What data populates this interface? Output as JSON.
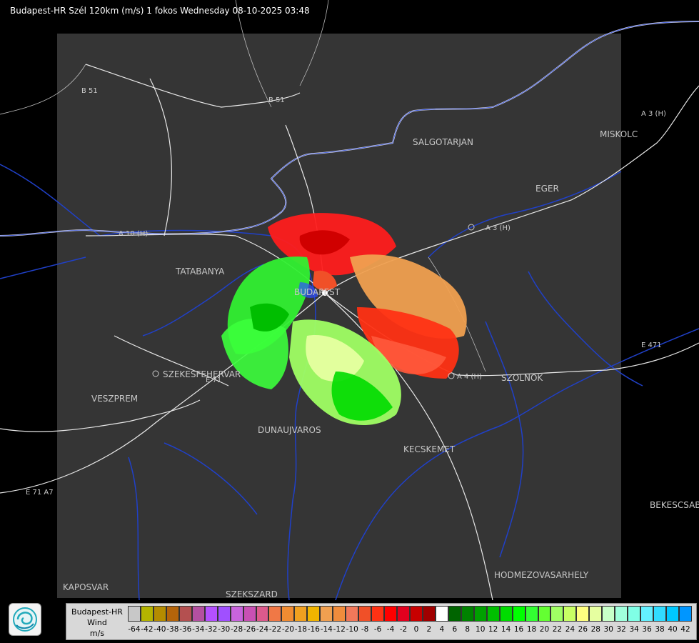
{
  "title": "Budapest-HR Szél 120km (m/s) 1 fokos Wednesday 08-10-2025 03:48",
  "cities": [
    {
      "name": "SALGOTARJAN"
    },
    {
      "name": "EGER"
    },
    {
      "name": "MISKOLC"
    },
    {
      "name": "TATABANYA"
    },
    {
      "name": "BUDAPEST"
    },
    {
      "name": "SZEKESFEHERVAR"
    },
    {
      "name": "VESZPREM"
    },
    {
      "name": "DUNAUJVAROS"
    },
    {
      "name": "KECSKEMET"
    },
    {
      "name": "SZOLNOK"
    },
    {
      "name": "HODMEZOVASARHELY"
    },
    {
      "name": "KAPOSVAR"
    },
    {
      "name": "SZEKSZARD"
    },
    {
      "name": "BEKESCSABA"
    }
  ],
  "roads": [
    {
      "name": "B 51"
    },
    {
      "name": "B 51"
    },
    {
      "name": "A 3 (H)"
    },
    {
      "name": "A 3 (H)"
    },
    {
      "name": "A 4 (H)"
    },
    {
      "name": "A 10 (H)"
    },
    {
      "name": "E 71"
    },
    {
      "name": "E 471"
    },
    {
      "name": "E 71 A7"
    }
  ],
  "legend": {
    "line1": "Budapest-HR",
    "line2": "Wind",
    "line3": "m/s",
    "colors": [
      "#c8c8c8",
      "#b4b400",
      "#b48c00",
      "#b4640a",
      "#b45050",
      "#b450a0",
      "#b450ff",
      "#a050ff",
      "#c864dc",
      "#c850b4",
      "#dc5a8c",
      "#f07846",
      "#f08c32",
      "#f0a020",
      "#f0b400",
      "#f0a050",
      "#f08c3c",
      "#f0785a",
      "#f05028",
      "#ff3214",
      "#ff0000",
      "#e1001e",
      "#c80000",
      "#a00000",
      "#ffffff",
      "#006400",
      "#008200",
      "#00a000",
      "#00be00",
      "#00dc00",
      "#00ff00",
      "#32ff32",
      "#64ff32",
      "#a0ff64",
      "#c8ff64",
      "#ffff80",
      "#e6ffa0",
      "#c8ffc8",
      "#a0ffdc",
      "#80ffe6",
      "#64f0ff",
      "#32dcff",
      "#00c8ff",
      "#0096ff",
      "#0064ff",
      "#0032ff",
      "#0000ff"
    ],
    "ticks": [
      "-64",
      "-42",
      "-40",
      "-38",
      "-36",
      "-34",
      "-32",
      "-30",
      "-28",
      "-26",
      "-24",
      "-22",
      "-20",
      "-18",
      "-16",
      "-14",
      "-12",
      "-10",
      "-8",
      "-6",
      "-4",
      "-2",
      "0",
      "2",
      "4",
      "6",
      "8",
      "10",
      "12",
      "14",
      "16",
      "18",
      "20",
      "22",
      "24",
      "26",
      "28",
      "30",
      "32",
      "34",
      "36",
      "38",
      "40",
      "42"
    ]
  }
}
